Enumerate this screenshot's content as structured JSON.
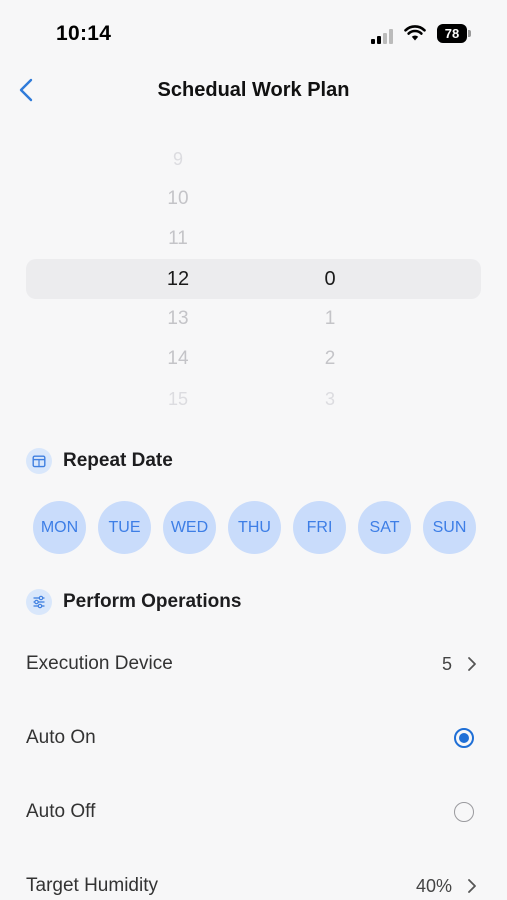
{
  "status_bar": {
    "time": "10:14",
    "battery": "78"
  },
  "header": {
    "title": "Schedual Work Plan"
  },
  "picker": {
    "hours": [
      "9",
      "10",
      "11",
      "12",
      "13",
      "14",
      "15"
    ],
    "minutes": [
      "0",
      "1",
      "2",
      "3"
    ],
    "selected_hour": "12",
    "selected_minute": "0"
  },
  "repeat_date": {
    "title": "Repeat Date",
    "days": [
      "MON",
      "TUE",
      "WED",
      "THU",
      "FRI",
      "SAT",
      "SUN"
    ]
  },
  "perform_operations": {
    "title": "Perform Operations",
    "execution_device": {
      "label": "Execution Device",
      "value": "5"
    },
    "auto_on": {
      "label": "Auto On",
      "checked": true
    },
    "auto_off": {
      "label": "Auto Off",
      "checked": false
    },
    "target_humidity": {
      "label": "Target Humidity",
      "value": "40%"
    }
  },
  "colors": {
    "accent": "#1f6fd6",
    "chip_bg": "#c9dcfb",
    "chip_text": "#3d7ee6"
  }
}
